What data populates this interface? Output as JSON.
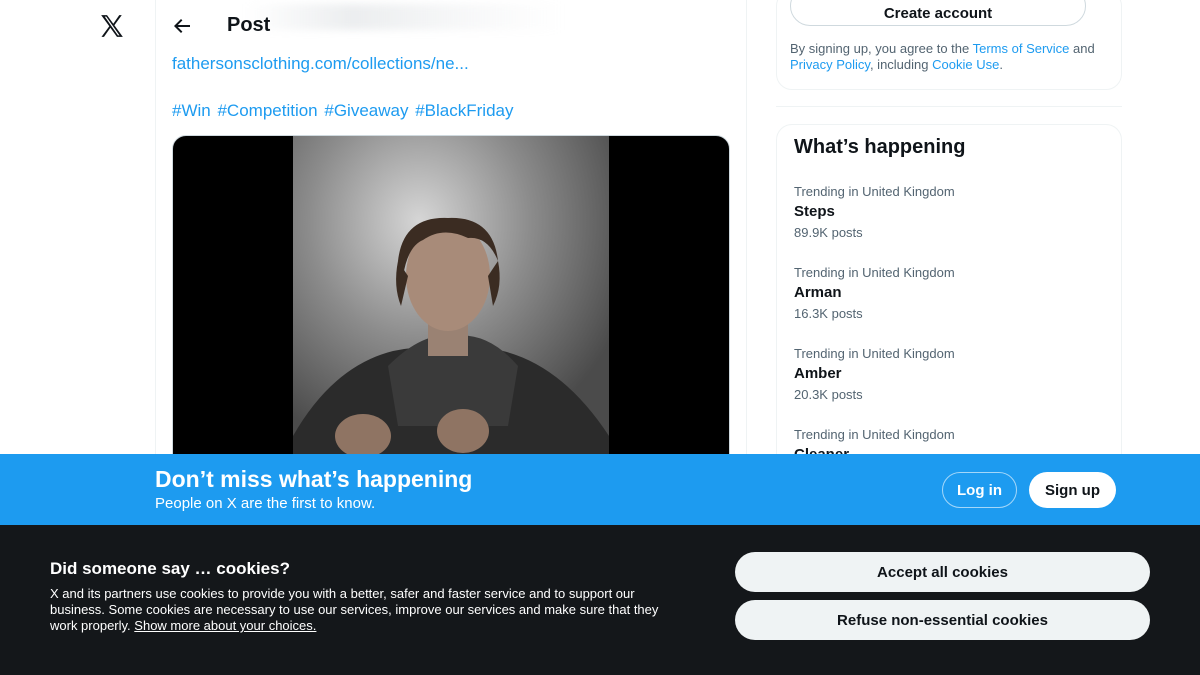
{
  "nav": {
    "logo_icon": "x-logo-icon"
  },
  "post": {
    "header_title": "Post",
    "back_icon": "arrow-left-icon",
    "link_text": "fathersonsclothing.com/collections/ne...",
    "hashtags": [
      "#Win",
      "#Competition",
      "#Giveaway",
      "#BlackFriday"
    ]
  },
  "sidebar": {
    "create_account_label": "Create account",
    "terms": {
      "prefix": "By signing up, you agree to the ",
      "tos": "Terms of Service",
      "and": " and ",
      "privacy": "Privacy Policy",
      "including": ", including ",
      "cookie": "Cookie Use",
      "end": "."
    },
    "trends_heading": "What’s happening",
    "trends": [
      {
        "context": "Trending in United Kingdom",
        "name": "Steps",
        "count": "89.9K posts"
      },
      {
        "context": "Trending in United Kingdom",
        "name": "Arman",
        "count": "16.3K posts"
      },
      {
        "context": "Trending in United Kingdom",
        "name": "Amber",
        "count": "20.3K posts"
      },
      {
        "context": "Trending in United Kingdom",
        "name": "Cleaner",
        "count": ""
      }
    ]
  },
  "banner": {
    "title": "Don’t miss what’s happening",
    "subtitle": "People on X are the first to know.",
    "login_label": "Log in",
    "signup_label": "Sign up",
    "color": "#1d9bf0"
  },
  "cookies": {
    "title": "Did someone say … cookies?",
    "text": "X and its partners use cookies to provide you with a better, safer and faster service and to support our business. Some cookies are necessary to use our services, improve our services and make sure that they work properly. ",
    "link": "Show more about your choices.",
    "accept_label": "Accept all cookies",
    "refuse_label": "Refuse non-essential cookies"
  }
}
